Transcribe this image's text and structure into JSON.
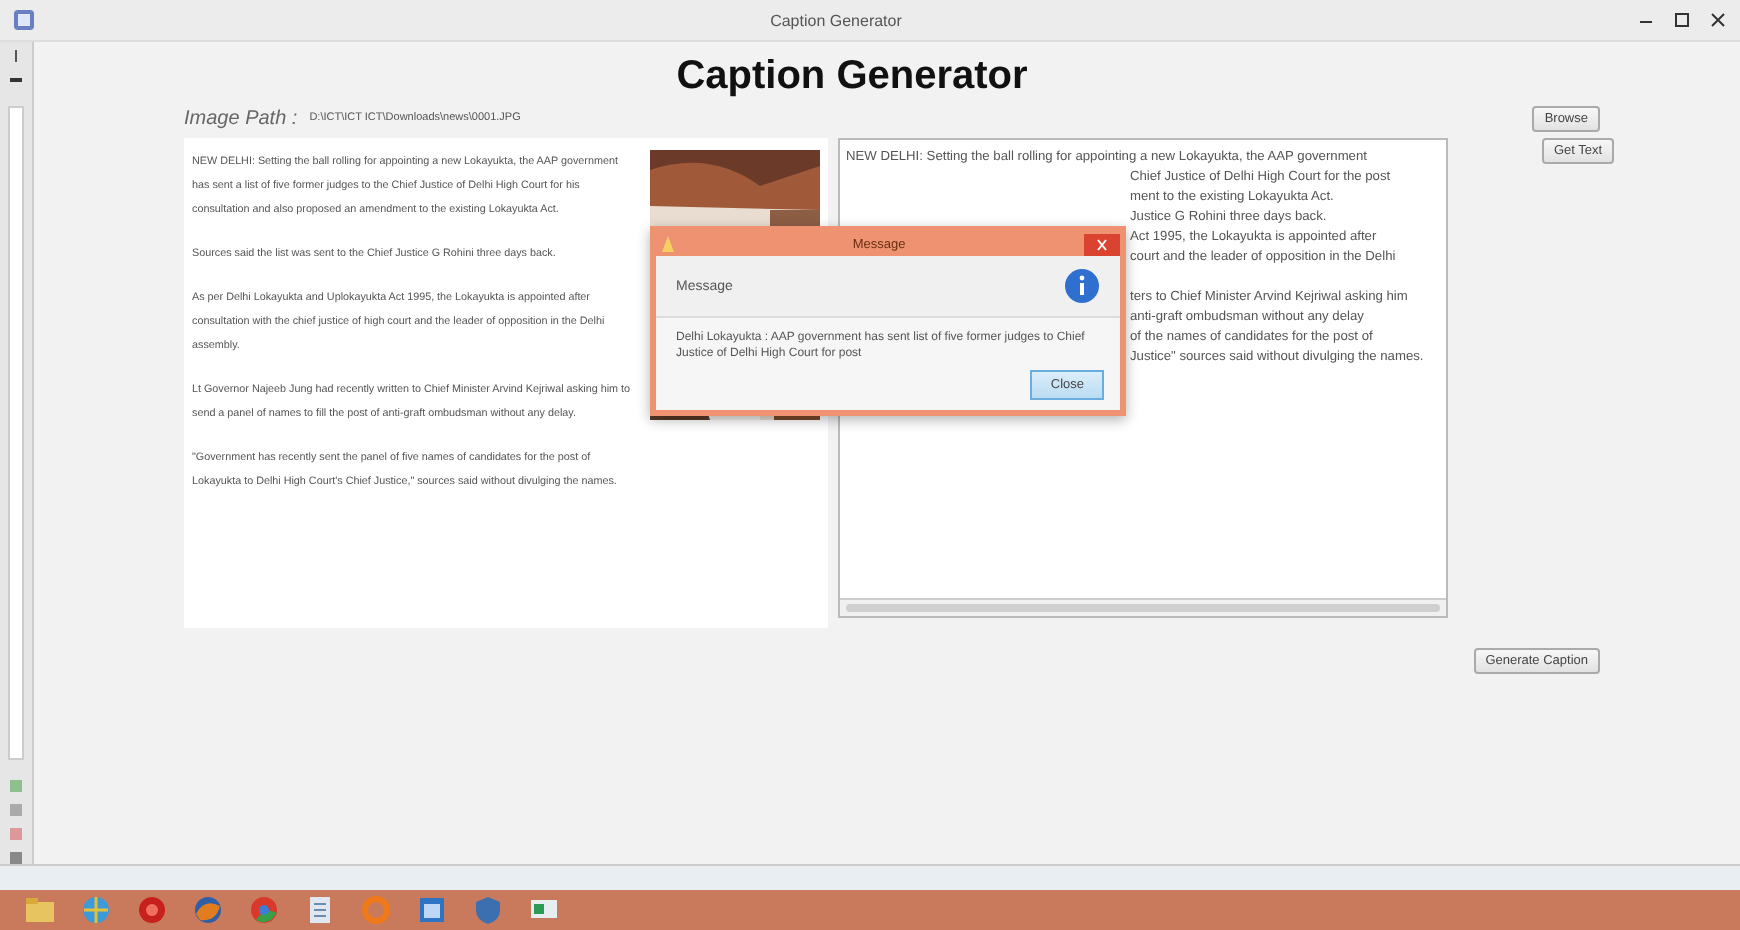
{
  "window": {
    "title": "Caption Generator"
  },
  "heading": "Caption Generator",
  "image_path": {
    "label": "Image Path :",
    "value": "D:\\ICT\\ICT ICT\\Downloads\\news\\0001.JPG"
  },
  "buttons": {
    "browse": "Browse",
    "get_text": "Get Text",
    "generate": "Generate Caption"
  },
  "article_paragraphs": [
    "NEW DELHI: Setting the ball rolling for appointing a new Lokayukta, the AAP government has sent a list of five former judges to the Chief Justice of Delhi High Court for his consultation and also proposed an amendment to the existing Lokayukta Act.",
    "Sources said the list was sent to the Chief Justice G Rohini three days back.",
    "As per Delhi Lokayukta and Uplokayukta Act 1995, the Lokayukta is appointed after consultation with the chief justice of high court and the leader of opposition in the Delhi assembly.",
    "Lt Governor Najeeb Jung had recently written to Chief Minister Arvind Kejriwal asking him to send a panel of names to fill the post of anti-graft ombudsman without any delay.",
    "\"Government has recently sent the panel of five names of candidates for the post of Lokayukta to Delhi High Court's Chief Justice,\" sources said without divulging the names."
  ],
  "picture": {
    "kind": "picture"
  },
  "text_blocks": [
    [
      "NEW DELHI: Setting the ball rolling for appointing a new Lokayukta, the AAP government",
      "Chief Justice of Delhi High Court for the post",
      "ment to the existing Lokayukta Act.",
      "Justice G Rohini three days back.",
      "Act 1995, the Lokayukta is appointed after",
      "court and the leader of opposition in the Delhi"
    ],
    [
      "ters to Chief Minister Arvind Kejriwal asking him",
      "anti-graft ombudsman without any delay",
      "of the names of candidates for the post of",
      "Justice\" sources said without divulging the names."
    ]
  ],
  "dialog": {
    "title": "Message",
    "header": "Message",
    "text": "Delhi Lokayukta : AAP government has sent list of five former judges to Chief Justice of Delhi High Court for post",
    "button": "Close"
  }
}
